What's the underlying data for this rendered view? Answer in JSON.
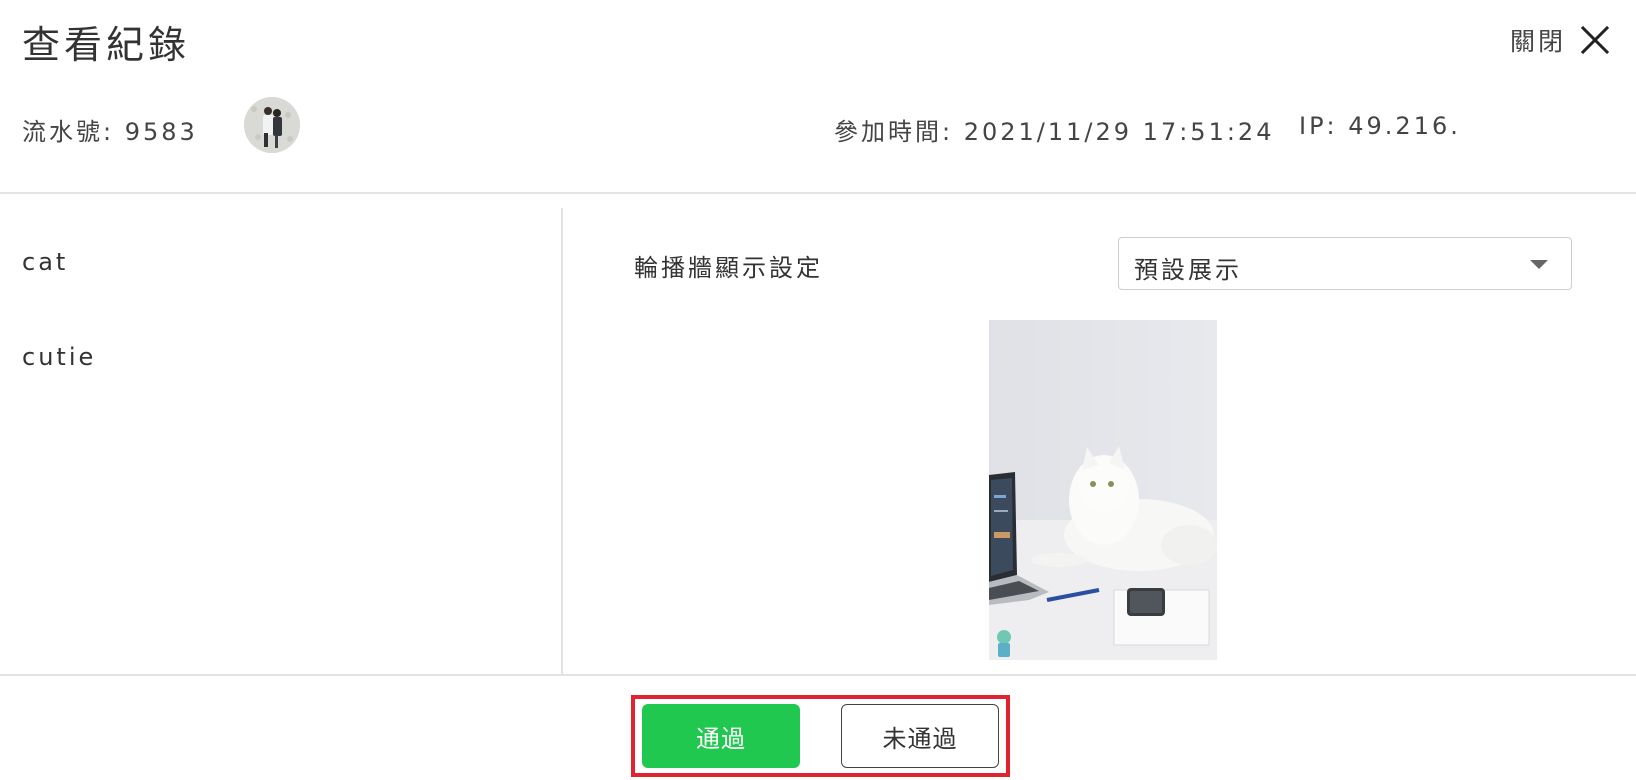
{
  "header": {
    "title": "查看紀錄",
    "close_label": "關閉",
    "close_icon": "close-icon"
  },
  "meta": {
    "serial_text": "流水號: 9583",
    "joined_text": "參加時間: 2021/11/29 17:51:24",
    "ip_text": "IP: 49.216."
  },
  "tags": [
    "cat",
    "cutie"
  ],
  "settings": {
    "carousel_label": "輪播牆顯示設定",
    "carousel_value": "預設展示"
  },
  "actions": {
    "approve_label": "通過",
    "reject_label": "未通過"
  },
  "colors": {
    "approve": "#21c84f",
    "highlight": "#e1222f"
  }
}
